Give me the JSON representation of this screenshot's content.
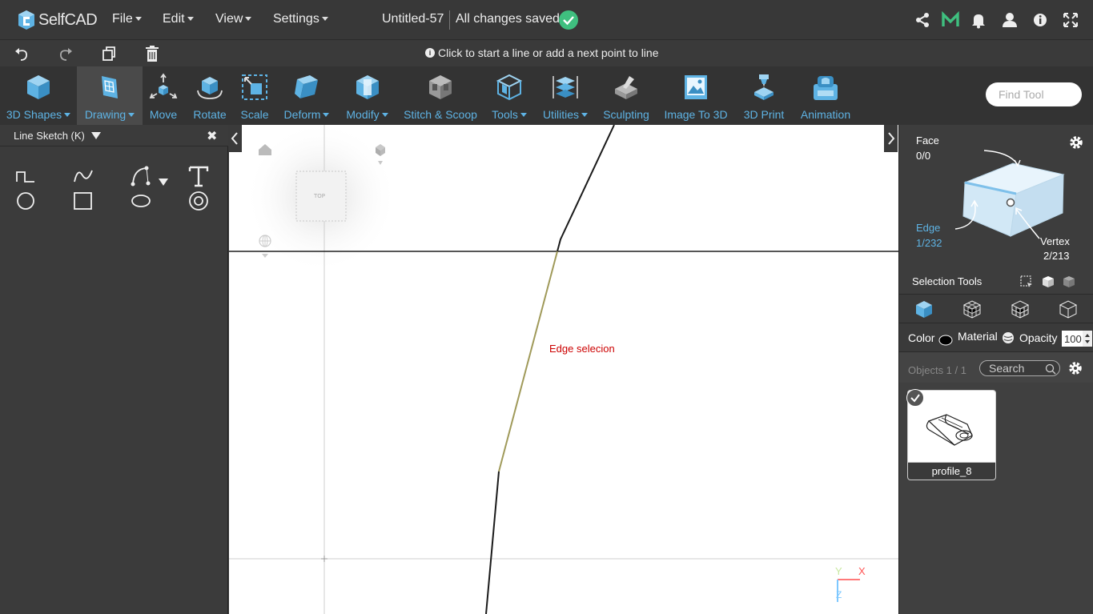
{
  "app": {
    "name": "SelfCAD"
  },
  "menu": {
    "file": "File",
    "edit": "Edit",
    "view": "View",
    "settings": "Settings"
  },
  "document": {
    "title": "Untitled-57",
    "save_status": "All changes saved"
  },
  "hint": "Click to start a line or add a next point to line",
  "toolbar": {
    "tools": [
      {
        "label": "3D Shapes"
      },
      {
        "label": "Drawing"
      },
      {
        "label": "Move"
      },
      {
        "label": "Rotate"
      },
      {
        "label": "Scale"
      },
      {
        "label": "Deform"
      },
      {
        "label": "Modify"
      },
      {
        "label": "Stitch & Scoop"
      },
      {
        "label": "Tools"
      },
      {
        "label": "Utilities"
      },
      {
        "label": "Sculpting"
      },
      {
        "label": "Image To 3D"
      },
      {
        "label": "3D Print"
      },
      {
        "label": "Animation"
      }
    ],
    "find_placeholder": "Find Tool"
  },
  "left_panel": {
    "title": "Line Sketch (K)"
  },
  "viewport": {
    "view_cube_label": "TOP",
    "annotation": "Edge selecion",
    "axis_x": "X",
    "axis_y": "Y",
    "axis_z": "Z"
  },
  "selection": {
    "face_label": "Face",
    "face_count": "0/0",
    "edge_label": "Edge",
    "edge_count": "1/232",
    "vertex_label": "Vertex",
    "vertex_count": "2/213",
    "tools_label": "Selection Tools"
  },
  "properties": {
    "color_label": "Color",
    "material_label": "Material",
    "opacity_label": "Opacity",
    "opacity_value": "100"
  },
  "objects": {
    "count_label": "Objects 1 / 1",
    "search_placeholder": "Search",
    "items": [
      {
        "name": "profile_8"
      }
    ]
  },
  "colors": {
    "accent": "#5eb3e4",
    "save_ok": "#3fbf7f",
    "annotation": "#cc0000",
    "selected_edge": "#a09a5a"
  }
}
